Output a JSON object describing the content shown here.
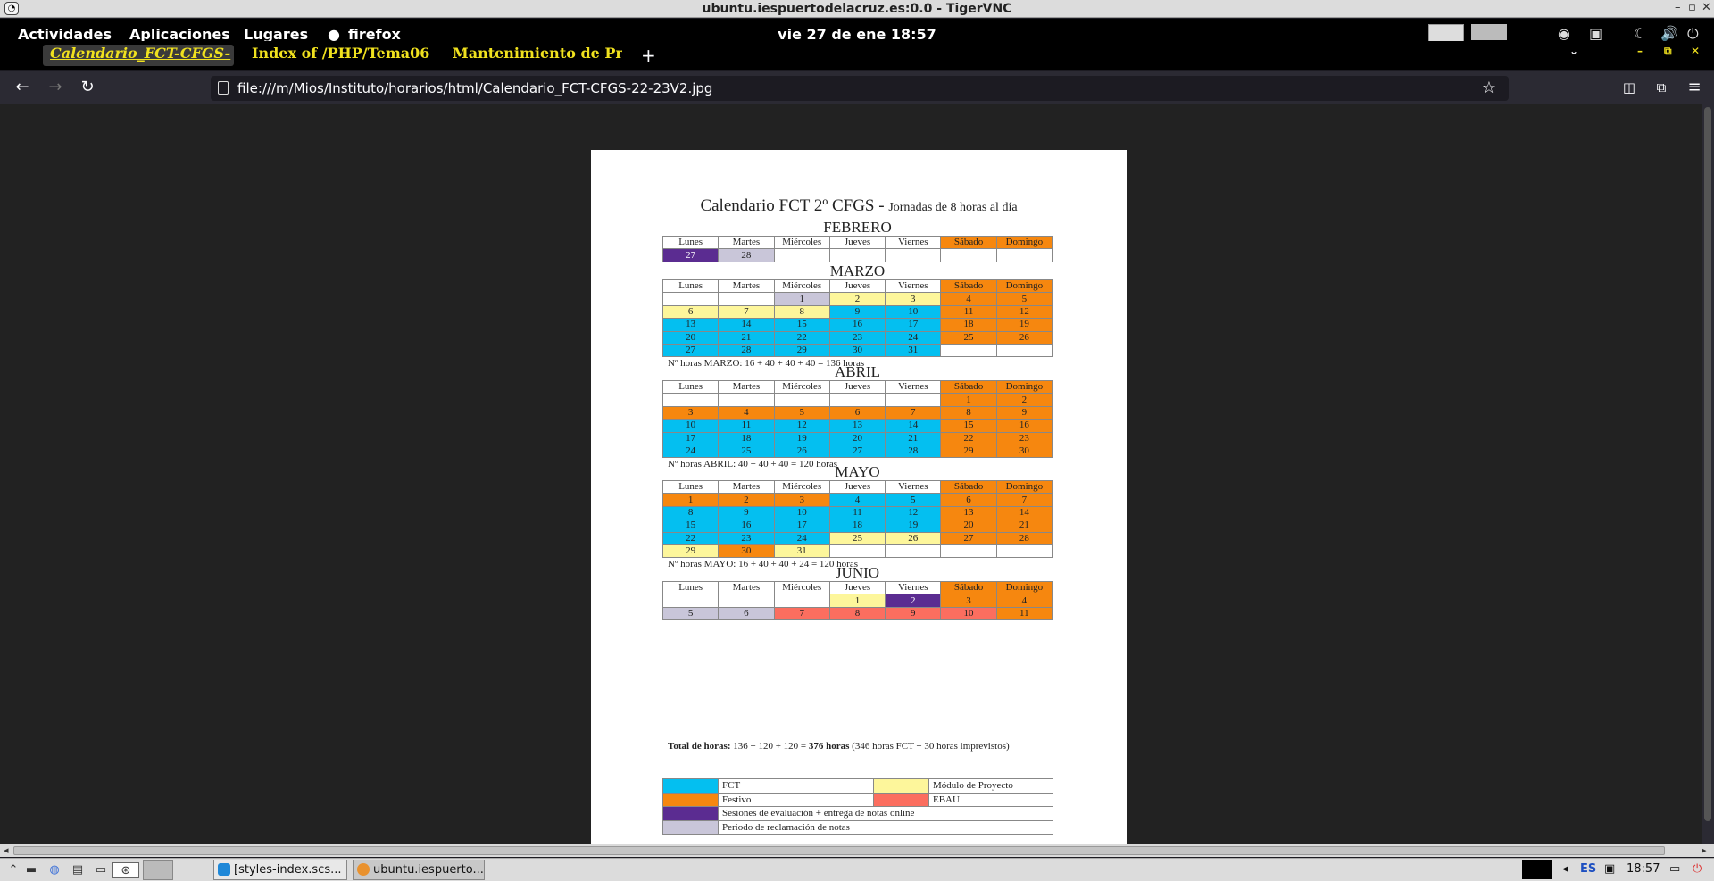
{
  "vnc": {
    "title": "ubuntu.iespuertodelacruz.es:0.0 - TigerVNC"
  },
  "gnome": {
    "activities": "Actividades",
    "applications": "Aplicaciones",
    "places": "Lugares",
    "app": "firefox",
    "clock": "vie 27 de ene  18:57"
  },
  "tabs": [
    {
      "label": "Calendario_FCT-CFGS-",
      "active": true
    },
    {
      "label": "Index of /PHP/Tema06",
      "active": false
    },
    {
      "label": "Mantenimiento de Proc",
      "active": false
    }
  ],
  "nav": {
    "url": "file:///m/Mios/Instituto/horarios/html/Calendario_FCT-CFGS-22-23V2.jpg"
  },
  "doc": {
    "title": "Calendario FCT 2º CFGS - ",
    "subtitle": "Jornadas de 8 horas al día",
    "headers": [
      "Lunes",
      "Martes",
      "Miércoles",
      "Jueves",
      "Viernes",
      "Sábado",
      "Domingo"
    ],
    "months": [
      {
        "name": "FEBRERO",
        "rows": [
          [
            [
              "27",
              "purple"
            ],
            [
              "28",
              "grey"
            ],
            [
              "",
              "w"
            ],
            [
              "",
              "w"
            ],
            [
              "",
              "w"
            ],
            [
              "",
              "w"
            ],
            [
              "",
              "w"
            ]
          ]
        ],
        "note": ""
      },
      {
        "name": "MARZO",
        "rows": [
          [
            [
              "",
              "w"
            ],
            [
              "",
              "w"
            ],
            [
              "1",
              "grey"
            ],
            [
              "2",
              "yellow"
            ],
            [
              "3",
              "yellow"
            ],
            [
              "4",
              "orange"
            ],
            [
              "5",
              "orange"
            ]
          ],
          [
            [
              "6",
              "yellow"
            ],
            [
              "7",
              "yellow"
            ],
            [
              "8",
              "yellow"
            ],
            [
              "9",
              "cyan"
            ],
            [
              "10",
              "cyan"
            ],
            [
              "11",
              "orange"
            ],
            [
              "12",
              "orange"
            ]
          ],
          [
            [
              "13",
              "cyan"
            ],
            [
              "14",
              "cyan"
            ],
            [
              "15",
              "cyan"
            ],
            [
              "16",
              "cyan"
            ],
            [
              "17",
              "cyan"
            ],
            [
              "18",
              "orange"
            ],
            [
              "19",
              "orange"
            ]
          ],
          [
            [
              "20",
              "cyan"
            ],
            [
              "21",
              "cyan"
            ],
            [
              "22",
              "cyan"
            ],
            [
              "23",
              "cyan"
            ],
            [
              "24",
              "cyan"
            ],
            [
              "25",
              "orange"
            ],
            [
              "26",
              "orange"
            ]
          ],
          [
            [
              "27",
              "cyan"
            ],
            [
              "28",
              "cyan"
            ],
            [
              "29",
              "cyan"
            ],
            [
              "30",
              "cyan"
            ],
            [
              "31",
              "cyan"
            ],
            [
              "",
              "w"
            ],
            [
              "",
              "w"
            ]
          ]
        ],
        "note": "Nº horas MARZO: 16 + 40 + 40 + 40 = 136 horas"
      },
      {
        "name": "ABRIL",
        "rows": [
          [
            [
              "",
              "w"
            ],
            [
              "",
              "w"
            ],
            [
              "",
              "w"
            ],
            [
              "",
              "w"
            ],
            [
              "",
              "w"
            ],
            [
              "1",
              "orange"
            ],
            [
              "2",
              "orange"
            ]
          ],
          [
            [
              "3",
              "orange"
            ],
            [
              "4",
              "orange"
            ],
            [
              "5",
              "orange"
            ],
            [
              "6",
              "orange"
            ],
            [
              "7",
              "orange"
            ],
            [
              "8",
              "orange"
            ],
            [
              "9",
              "orange"
            ]
          ],
          [
            [
              "10",
              "cyan"
            ],
            [
              "11",
              "cyan"
            ],
            [
              "12",
              "cyan"
            ],
            [
              "13",
              "cyan"
            ],
            [
              "14",
              "cyan"
            ],
            [
              "15",
              "orange"
            ],
            [
              "16",
              "orange"
            ]
          ],
          [
            [
              "17",
              "cyan"
            ],
            [
              "18",
              "cyan"
            ],
            [
              "19",
              "cyan"
            ],
            [
              "20",
              "cyan"
            ],
            [
              "21",
              "cyan"
            ],
            [
              "22",
              "orange"
            ],
            [
              "23",
              "orange"
            ]
          ],
          [
            [
              "24",
              "cyan"
            ],
            [
              "25",
              "cyan"
            ],
            [
              "26",
              "cyan"
            ],
            [
              "27",
              "cyan"
            ],
            [
              "28",
              "cyan"
            ],
            [
              "29",
              "orange"
            ],
            [
              "30",
              "orange"
            ]
          ]
        ],
        "note": "Nº horas ABRIL:  40 + 40 + 40 = 120 horas"
      },
      {
        "name": "MAYO",
        "rows": [
          [
            [
              "1",
              "orange"
            ],
            [
              "2",
              "orange"
            ],
            [
              "3",
              "orange"
            ],
            [
              "4",
              "cyan"
            ],
            [
              "5",
              "cyan"
            ],
            [
              "6",
              "orange"
            ],
            [
              "7",
              "orange"
            ]
          ],
          [
            [
              "8",
              "cyan"
            ],
            [
              "9",
              "cyan"
            ],
            [
              "10",
              "cyan"
            ],
            [
              "11",
              "cyan"
            ],
            [
              "12",
              "cyan"
            ],
            [
              "13",
              "orange"
            ],
            [
              "14",
              "orange"
            ]
          ],
          [
            [
              "15",
              "cyan"
            ],
            [
              "16",
              "cyan"
            ],
            [
              "17",
              "cyan"
            ],
            [
              "18",
              "cyan"
            ],
            [
              "19",
              "cyan"
            ],
            [
              "20",
              "orange"
            ],
            [
              "21",
              "orange"
            ]
          ],
          [
            [
              "22",
              "cyan"
            ],
            [
              "23",
              "cyan"
            ],
            [
              "24",
              "cyan"
            ],
            [
              "25",
              "yellow"
            ],
            [
              "26",
              "yellow"
            ],
            [
              "27",
              "orange"
            ],
            [
              "28",
              "orange"
            ]
          ],
          [
            [
              "29",
              "yellow"
            ],
            [
              "30",
              "orange"
            ],
            [
              "31",
              "yellow"
            ],
            [
              "",
              "w"
            ],
            [
              "",
              "w"
            ],
            [
              "",
              "w"
            ],
            [
              "",
              "w"
            ]
          ]
        ],
        "note": "Nº horas MAYO: 16 + 40 + 40 + 24  = 120 horas"
      },
      {
        "name": "JUNIO",
        "rows": [
          [
            [
              "",
              "w"
            ],
            [
              "",
              "w"
            ],
            [
              "",
              "w"
            ],
            [
              "1",
              "yellow"
            ],
            [
              "2",
              "purple"
            ],
            [
              "3",
              "orange"
            ],
            [
              "4",
              "orange"
            ]
          ],
          [
            [
              "5",
              "grey"
            ],
            [
              "6",
              "grey"
            ],
            [
              "7",
              "red"
            ],
            [
              "8",
              "red"
            ],
            [
              "9",
              "red"
            ],
            [
              "10",
              "red"
            ],
            [
              "11",
              "orange"
            ]
          ]
        ],
        "note": ""
      }
    ],
    "total": {
      "label": "Total de horas:",
      "formula": " 136 + 120 + 120 = ",
      "result": "376 horas",
      "detail": " (346 horas FCT + 30 horas imprevistos)"
    },
    "legend": {
      "fct": "FCT",
      "proyecto": "Módulo de Proyecto",
      "festivo": "Festivo",
      "ebau": "EBAU",
      "sesiones": "Sesiones de evaluación + entrega de notas online",
      "reclamacion": "Periodo de reclamación de notas"
    },
    "colors": {
      "cyan": "#04bff0",
      "yellow": "#fdf69b",
      "orange": "#f6870f",
      "purple": "#5b2c91",
      "grey": "#c9c6d9",
      "red": "#fb6e5f"
    }
  },
  "taskbar": {
    "tasks": [
      {
        "label": "[styles-index.scs...",
        "icon": "vscode-icon"
      },
      {
        "label": "ubuntu.iespuerto...",
        "icon": "tigervnc-icon"
      }
    ],
    "lang": "ES",
    "time": "18:57"
  }
}
